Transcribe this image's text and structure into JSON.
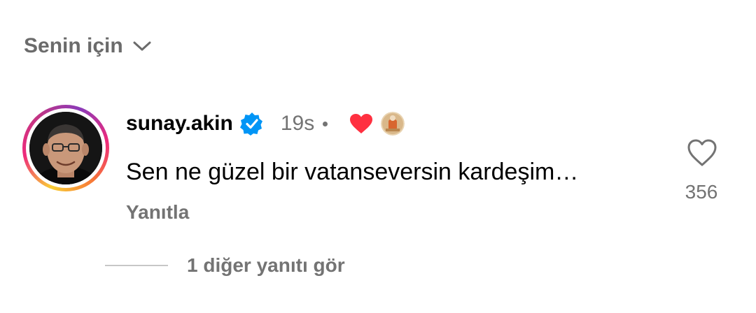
{
  "header": {
    "filter_label": "Senin için",
    "filter_icon": "chevron-down-icon"
  },
  "comment": {
    "username": "sunay.akin",
    "verified_icon": "verified-badge-icon",
    "time": "19s",
    "creator_liked_icon": "red-heart-icon",
    "text": "Sen ne güzel bir vatanseversin kardeşim…",
    "reply_label": "Yanıtla",
    "like_icon": "heart-outline-icon",
    "like_count": "356",
    "more_replies_label": "1 diğer yanıtı gör"
  },
  "colors": {
    "text_primary": "#000000",
    "text_secondary": "#737373",
    "verified_blue": "#0095f6",
    "heart_red": "#ff3040",
    "story_ring_start": "#f9ce34",
    "story_ring_mid": "#ee2a7b",
    "story_ring_end": "#8a3ab9"
  }
}
